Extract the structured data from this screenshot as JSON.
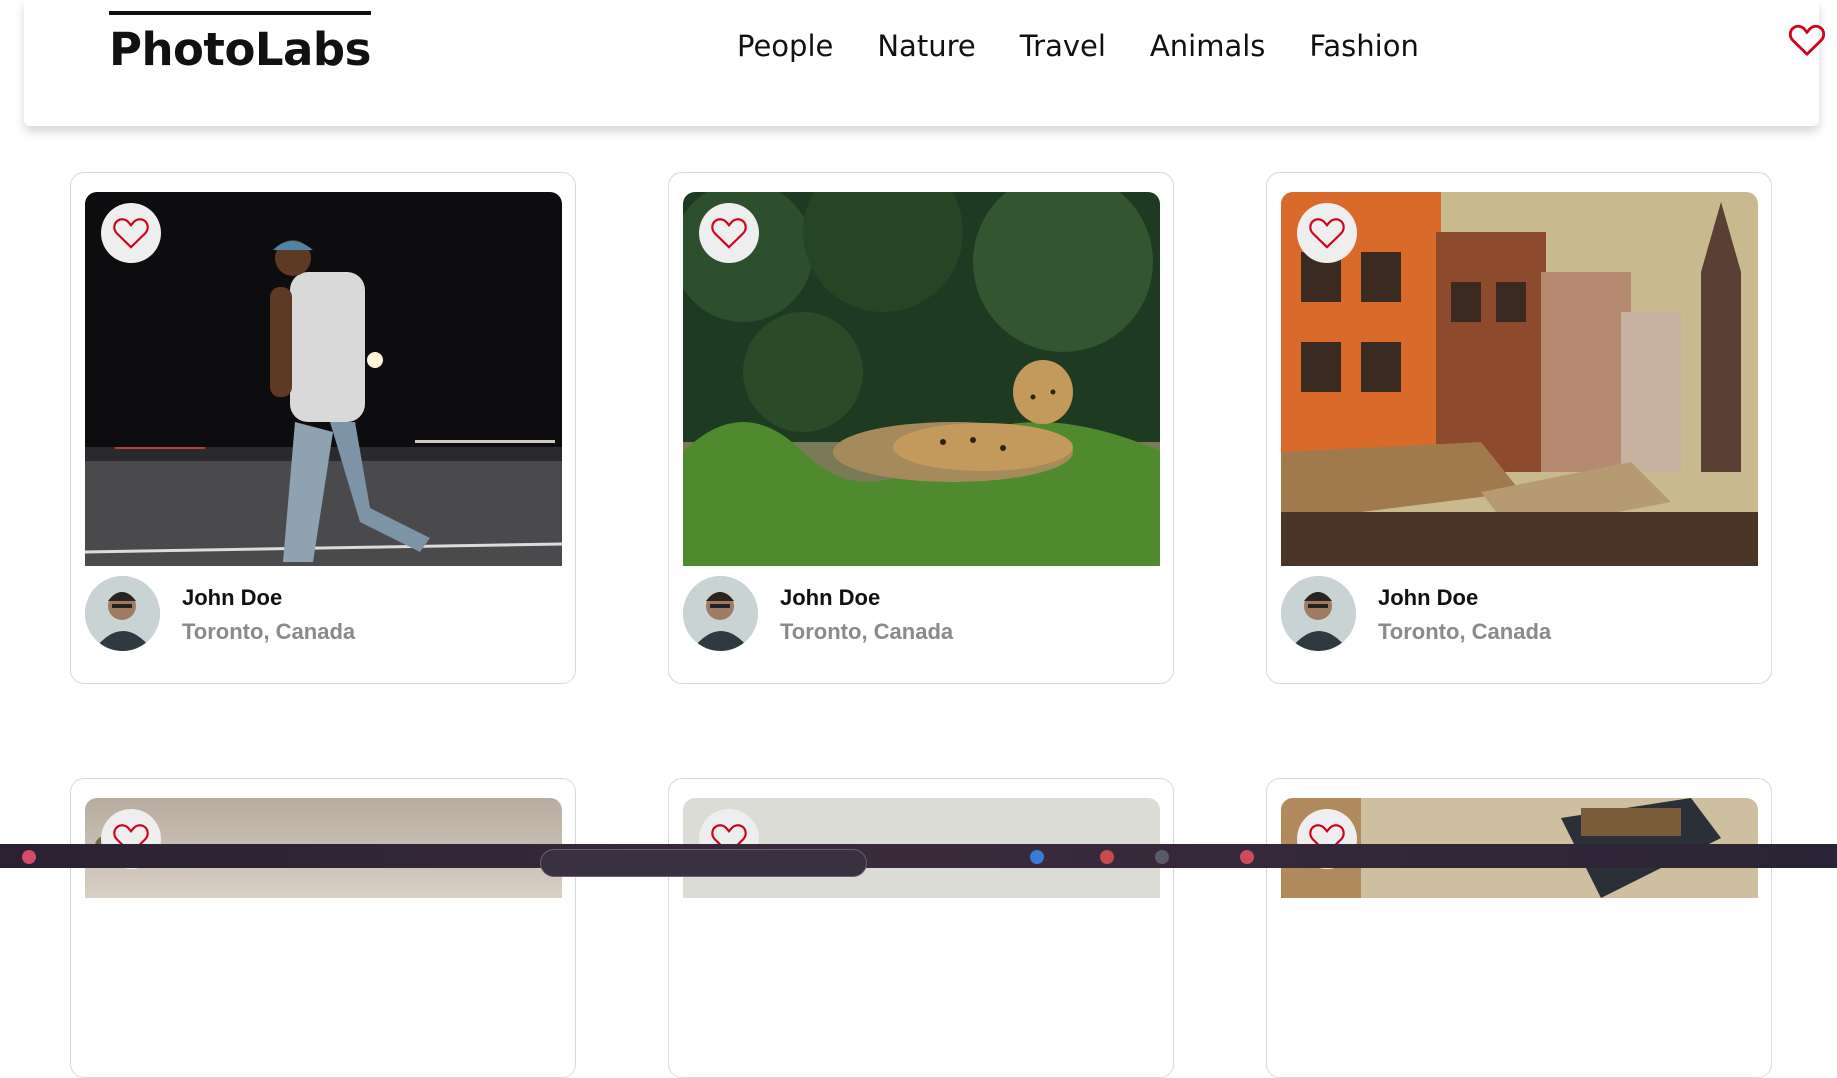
{
  "brand": {
    "name": "PhotoLabs"
  },
  "nav": {
    "topics": [
      "People",
      "Nature",
      "Travel",
      "Animals",
      "Fashion"
    ],
    "favourites_icon": "heart-outline-icon"
  },
  "colors": {
    "heart": "#d0021b",
    "like_bg": "#eeeeee",
    "location": "#8a8a8a"
  },
  "photos": [
    {
      "scene": "man walking at night",
      "user": {
        "name": "John Doe",
        "location": "Toronto, Canada"
      }
    },
    {
      "scene": "leopard in grass",
      "user": {
        "name": "John Doe",
        "location": "Toronto, Canada"
      }
    },
    {
      "scene": "old town buildings",
      "user": {
        "name": "John Doe",
        "location": "Toronto, Canada"
      }
    },
    {
      "scene": "hazy landscape"
    },
    {
      "scene": "pale grey sky"
    },
    {
      "scene": "food on phone"
    }
  ]
}
